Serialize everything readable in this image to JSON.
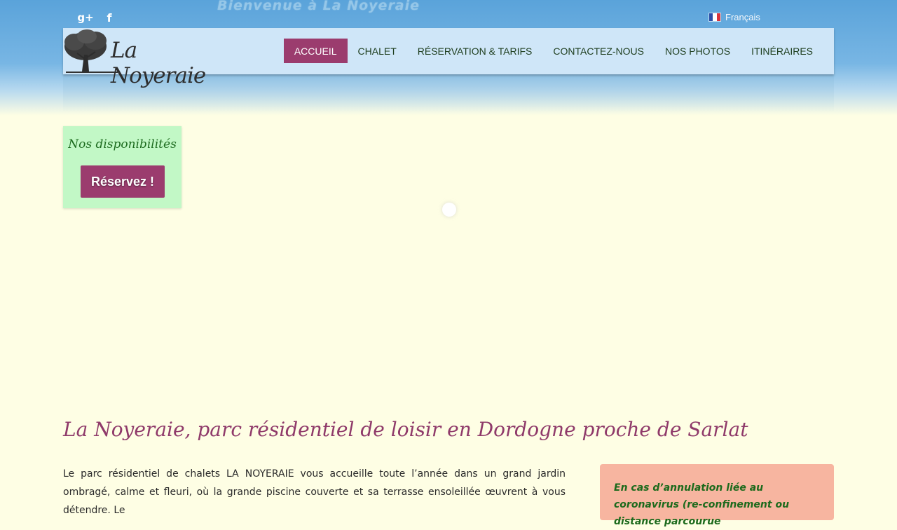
{
  "banner": {
    "welcome_text": "Bienvenue à La Noyeraie"
  },
  "social": {
    "gplus_label": "g+",
    "facebook_label": "f"
  },
  "language": {
    "current": "Français"
  },
  "logo": {
    "text": "La Noyeraie"
  },
  "nav": {
    "items": [
      {
        "label": "ACCUEIL",
        "active": true
      },
      {
        "label": "CHALET"
      },
      {
        "label": "RÉSERVATION & TARIFS"
      },
      {
        "label": "CONTACTEZ-NOUS"
      },
      {
        "label": "NOS PHOTOS"
      },
      {
        "label": "ITINÉRAIRES"
      }
    ]
  },
  "availability": {
    "title": "Nos disponibilités",
    "button_label": "Réservez !"
  },
  "main": {
    "title": "La Noyeraie, parc résidentiel de loisir en Dordogne proche de Sarlat",
    "intro": "Le parc résidentiel de chalets LA NOYERAIE vous accueille toute l’année dans un grand jardin ombragé, calme et fleuri, où la grande piscine couverte et sa terrasse ensoleillée œuvrent à vous détendre. Le"
  },
  "notice": {
    "title": "En cas d’annulation liée au coronavirus (re-confinement ou distance parcourue"
  },
  "colors": {
    "accent": "#9b3c6e",
    "header_bg": "#cfe6f8",
    "page_bg": "#fefee4",
    "availability_bg": "#c2f8c6",
    "notice_bg": "#f7b5a0"
  }
}
